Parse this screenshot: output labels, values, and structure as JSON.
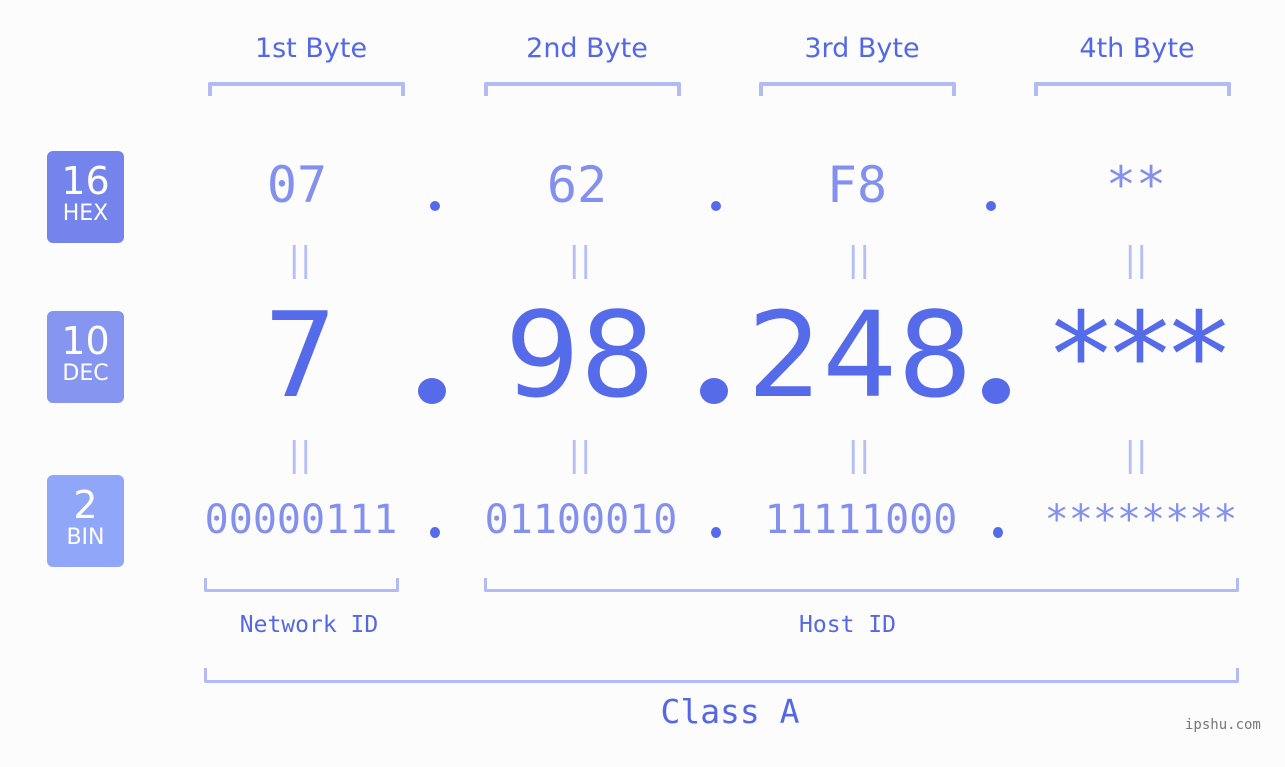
{
  "byte_headers": [
    "1st Byte",
    "2nd Byte",
    "3rd Byte",
    "4th Byte"
  ],
  "bases": {
    "hex": {
      "number": "16",
      "label": "HEX",
      "color": "#7584ec"
    },
    "dec": {
      "number": "10",
      "label": "DEC",
      "color": "#8595f0"
    },
    "bin": {
      "number": "2",
      "label": "BIN",
      "color": "#90a6f8"
    }
  },
  "hex_values": [
    "07",
    "62",
    "F8",
    "**"
  ],
  "dec_values": [
    "7",
    "98",
    "248",
    "***"
  ],
  "bin_values": [
    "00000111",
    "01100010",
    "11111000",
    "********"
  ],
  "equals_symbol": "||",
  "network_id_label": "Network ID",
  "host_id_label": "Host ID",
  "class_label": "Class A",
  "watermark": "ipshu.com",
  "colors": {
    "accent": "#556be9",
    "light_value": "#8390ee",
    "bracket": "#b2bbf6",
    "background": "#fbfcfb"
  }
}
